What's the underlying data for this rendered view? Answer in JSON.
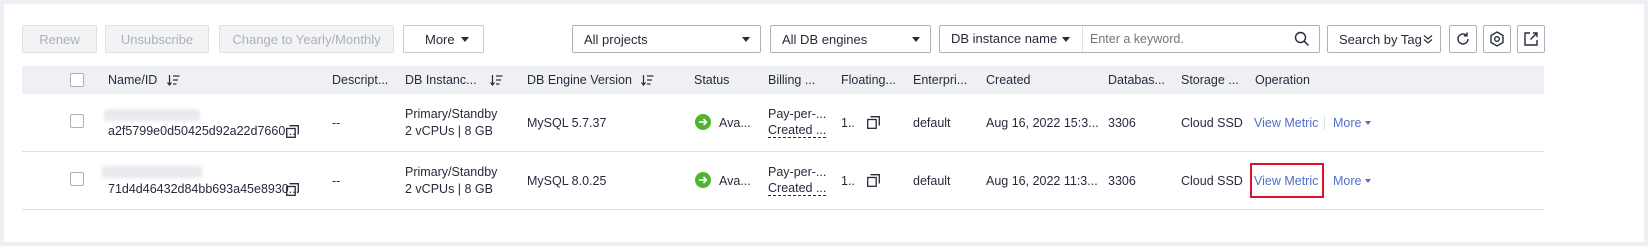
{
  "toolbar": {
    "renew": "Renew",
    "unsubscribe": "Unsubscribe",
    "change": "Change to Yearly/Monthly",
    "more": "More"
  },
  "filters": {
    "projects": "All projects",
    "engines": "All DB engines",
    "search_type": "DB instance name",
    "search_placeholder": "Enter a keyword.",
    "search_by_tag": "Search by Tag"
  },
  "table": {
    "columns": [
      "Name/ID",
      "Descript...",
      "DB Instanc...",
      "DB Engine Version",
      "Status",
      "Billing ...",
      "Floating...",
      "Enterpri...",
      "Created",
      "Databas...",
      "Storage ...",
      "Operation"
    ],
    "rows": [
      {
        "id": "a2f5799e0d50425d92a22d7660...",
        "description": "--",
        "instance_type": "Primary/Standby",
        "instance_spec": "2 vCPUs | 8 GB",
        "engine": "MySQL 5.7.37",
        "status": "Ava...",
        "billing_1": "Pay-per-...",
        "billing_2": "Created ...",
        "floating": "1..",
        "enterprise": "default",
        "created": "Aug 16, 2022 15:3...",
        "port": "3306",
        "storage": "Cloud SSD",
        "view_metric": "View Metric",
        "more": "More"
      },
      {
        "id": "71d4d46432d84bb693a45e8930...",
        "description": "--",
        "instance_type": "Primary/Standby",
        "instance_spec": "2 vCPUs | 8 GB",
        "engine": "MySQL 8.0.25",
        "status": "Ava...",
        "billing_1": "Pay-per-...",
        "billing_2": "Created ...",
        "floating": "1..",
        "enterprise": "default",
        "created": "Aug 16, 2022 11:3...",
        "port": "3306",
        "storage": "Cloud SSD",
        "view_metric": "View Metric",
        "more": "More"
      }
    ]
  },
  "colors": {
    "link": "#526ecc",
    "status_ok": "#50b432",
    "highlight": "#e0102f"
  }
}
